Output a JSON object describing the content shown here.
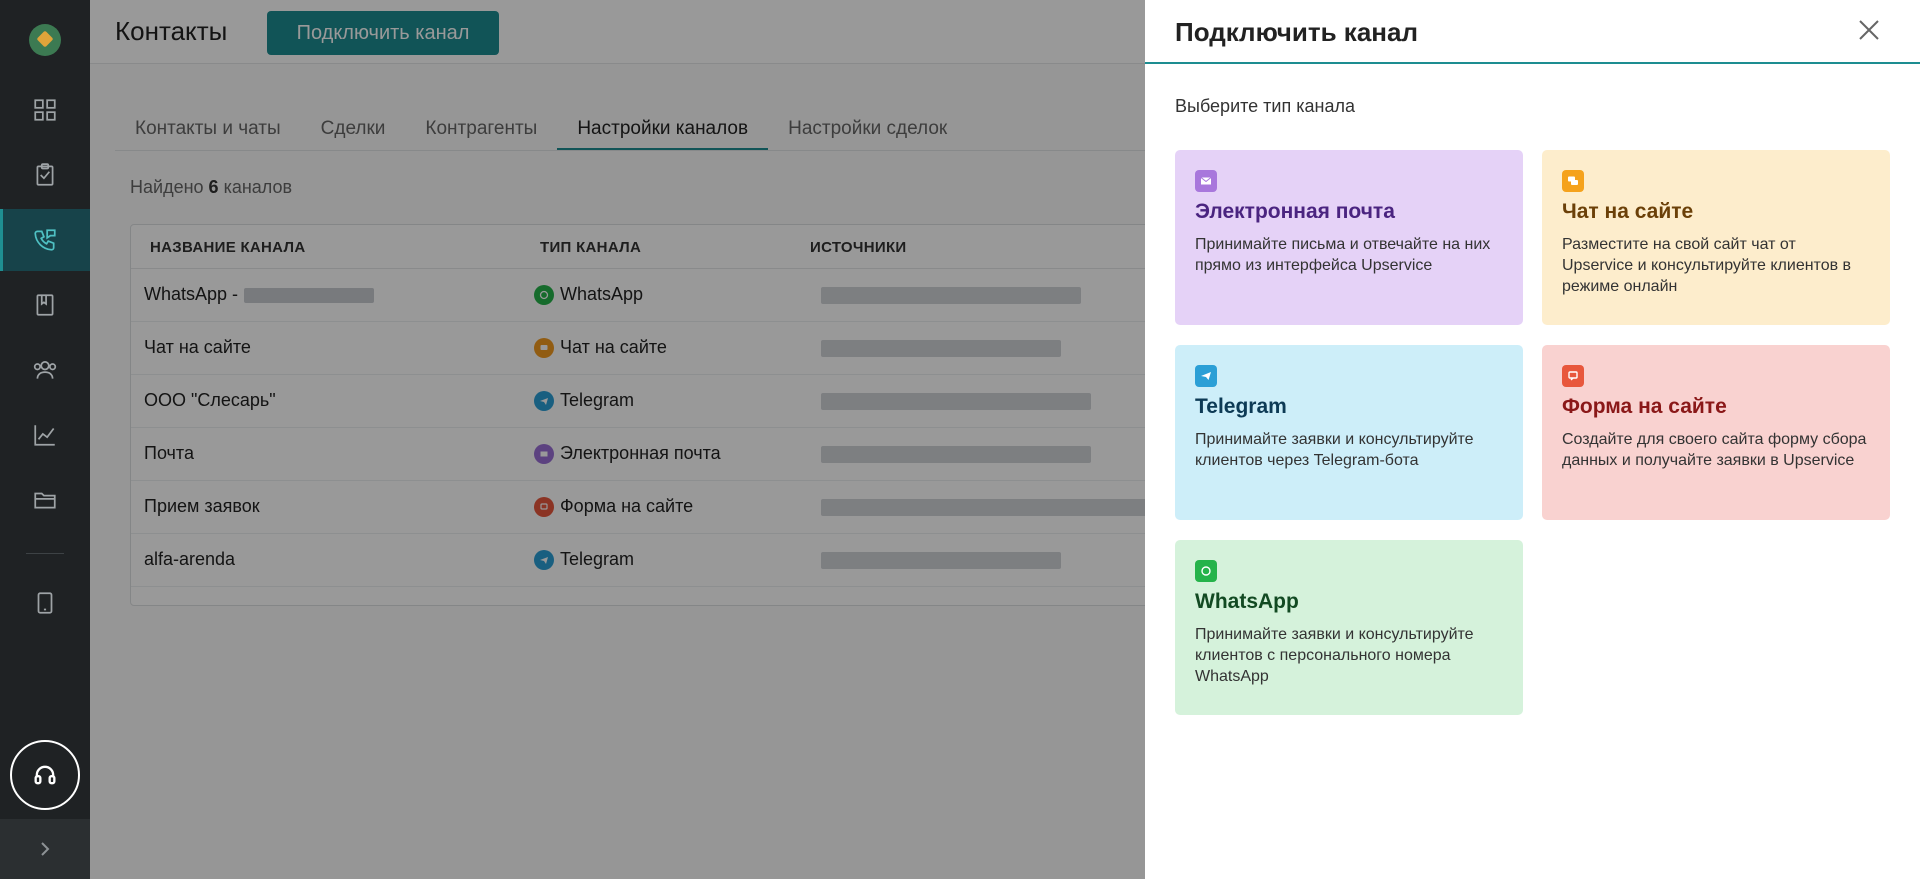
{
  "sidebar": {
    "items": [
      {
        "name": "dashboard",
        "icon": "grid-icon"
      },
      {
        "name": "tasks",
        "icon": "clipboard-icon"
      },
      {
        "name": "contacts",
        "icon": "phone-chat-icon",
        "active": true
      },
      {
        "name": "documents",
        "icon": "book-icon"
      },
      {
        "name": "users",
        "icon": "users-icon"
      },
      {
        "name": "reports",
        "icon": "chart-icon"
      },
      {
        "name": "files",
        "icon": "folder-icon"
      },
      {
        "name": "devices",
        "icon": "tablet-icon"
      }
    ],
    "support_icon": "headset-icon",
    "expand_icon": "chevron-right-icon"
  },
  "header": {
    "title": "Контакты",
    "connect_button": "Подключить канал"
  },
  "tabs": [
    {
      "label": "Контакты и чаты",
      "active": false
    },
    {
      "label": "Сделки",
      "active": false
    },
    {
      "label": "Контрагенты",
      "active": false
    },
    {
      "label": "Настройки каналов",
      "active": true
    },
    {
      "label": "Настройки сделок",
      "active": false
    }
  ],
  "found": {
    "prefix": "Найдено",
    "count": "6",
    "suffix": "каналов"
  },
  "table": {
    "columns": [
      "НАЗВАНИЕ КАНАЛА",
      "ТИП КАНАЛА",
      "ИСТОЧНИКИ"
    ],
    "rows": [
      {
        "name": "WhatsApp -",
        "type": "WhatsApp",
        "type_icon": "whatsapp-icon",
        "color": "#25b34a"
      },
      {
        "name": "Чат на сайте",
        "type": "Чат на сайте",
        "type_icon": "chat-icon",
        "color": "#f29a1e"
      },
      {
        "name": "ООО \"Слесарь\"",
        "type": "Telegram",
        "type_icon": "telegram-icon",
        "color": "#2b9fd6"
      },
      {
        "name": "Почта",
        "type": "Электронная почта",
        "type_icon": "mail-icon",
        "color": "#9a6fd6"
      },
      {
        "name": "Прием заявок",
        "type": "Форма на сайте",
        "type_icon": "form-icon",
        "color": "#e8573c"
      },
      {
        "name": "alfa-arenda",
        "type": "Telegram",
        "type_icon": "telegram-icon",
        "color": "#2b9fd6"
      }
    ],
    "link_fragment": "7-"
  },
  "panel": {
    "title": "Подключить канал",
    "subtitle": "Выберите тип канала",
    "close_icon": "close-icon",
    "cards": [
      {
        "key": "email",
        "title": "Электронная почта",
        "desc": "Принимайте письма и отвечайте на них прямо из интерфейса Upservice",
        "bg": "#e5d2f7",
        "title_color": "#4a2480",
        "icon_bg": "#a877dc",
        "icon": "mail-icon"
      },
      {
        "key": "site_chat",
        "title": "Чат на сайте",
        "desc": "Разместите на свой сайт чат от Upservice и консультируйте клиентов в режиме онлайн",
        "bg": "#fdedcc",
        "title_color": "#6b4008",
        "icon_bg": "#f5a21c",
        "icon": "chat-icon"
      },
      {
        "key": "telegram",
        "title": "Telegram",
        "desc": "Принимайте заявки и консультируйте клиентов через Telegram-бота",
        "bg": "#cdeef9",
        "title_color": "#0d3a55",
        "icon_bg": "#2b9fd6",
        "icon": "telegram-icon"
      },
      {
        "key": "site_form",
        "title": "Форма на сайте",
        "desc": "Создайте для своего сайта форму сбора данных и получайте заявки в Upservice",
        "bg": "#f9d2d0",
        "title_color": "#8a1818",
        "icon_bg": "#e8573c",
        "icon": "form-icon"
      },
      {
        "key": "whatsapp",
        "title": "WhatsApp",
        "desc": "Принимайте заявки и консультируйте клиентов с персонального номера WhatsApp",
        "bg": "#d5f2db",
        "title_color": "#124a22",
        "icon_bg": "#25b34a",
        "icon": "whatsapp-icon"
      }
    ]
  }
}
